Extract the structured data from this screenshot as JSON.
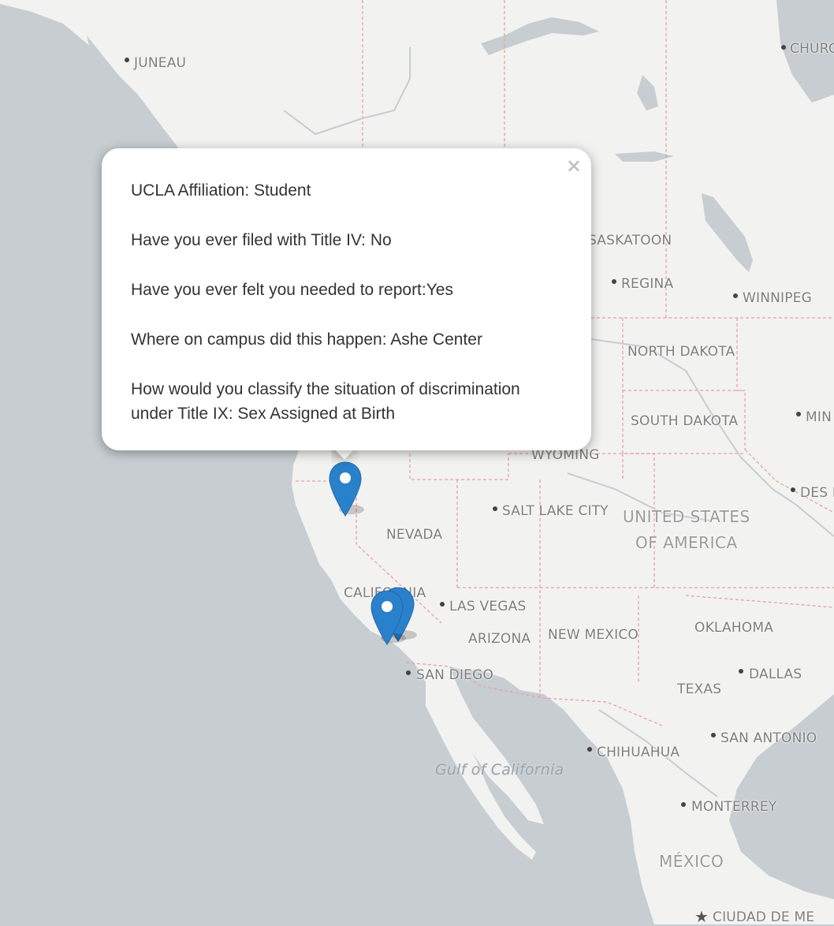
{
  "map": {
    "labels": {
      "juneau": "JUNEAU",
      "churchill": "CHURC",
      "saskatoon": "SASKATOON",
      "regina": "REGINA",
      "winnipeg": "WINNIPEG",
      "north_dakota": "NORTH DAKOTA",
      "south_dakota": "SOUTH DAKOTA",
      "minneapolis": "MIN",
      "wyoming": "WYOMING",
      "des_moines": "DES M",
      "salt_lake_city": "SALT LAKE CITY",
      "usa_line1": "UNITED STATES",
      "usa_line2": "OF AMERICA",
      "nevada": "NEVADA",
      "california": "CALIFORNIA",
      "las_vegas": "LAS VEGAS",
      "arizona": "ARIZONA",
      "new_mexico": "NEW MEXICO",
      "oklahoma": "OKLAHOMA",
      "dallas": "DALLAS",
      "texas": "TEXAS",
      "san_diego": "SAN DIEGO",
      "san_antonio": "SAN ANTONIO",
      "chihuahua": "CHIHUAHUA",
      "gulf_of_california": "Gulf of California",
      "monterrey": "MONTERREY",
      "mexico": "MÉXICO",
      "ciudad_de_mexico": "CIUDAD DE ME"
    },
    "colors": {
      "land": "#f2f2f0",
      "water": "#c7cdd1",
      "border": "#e6a3a3",
      "marker": "#2a81cb"
    },
    "markers": [
      {
        "name": "marker-northern-california",
        "selected": true
      },
      {
        "name": "marker-los-angeles-1"
      },
      {
        "name": "marker-los-angeles-2"
      }
    ]
  },
  "popup": {
    "close_label": "×",
    "lines": [
      "UCLA Affiliation: Student",
      "Have you ever filed with Title IV: No",
      "Have you ever felt you needed to report:Yes",
      "Where on campus did this happen: Ashe Center",
      "How would you classify the situation of discrimination under Title IX: Sex Assigned at Birth"
    ]
  }
}
